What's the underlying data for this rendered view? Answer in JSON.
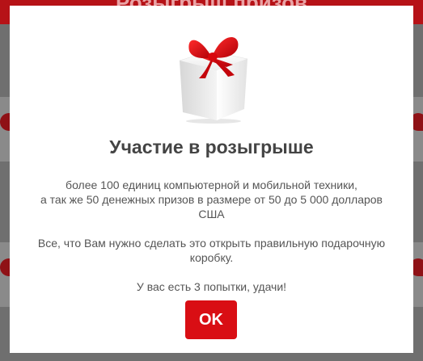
{
  "background": {
    "header_title": "Розыгрыш призов"
  },
  "modal": {
    "icon": "gift-box-icon",
    "title": "Участие в розыгрыше",
    "prizes_line1": "более 100 единиц компьютерной и мобильной техники,",
    "prizes_line2": "а так же 50 денежных призов в размере от 50 до 5 000 долларов США",
    "instructions": "Все, что Вам нужно сделать это открыть правильную подарочную коробку.",
    "attempts": "У вас есть 3 попытки, удачи!",
    "ok_label": "OK"
  },
  "colors": {
    "accent": "#d90e14",
    "header": "#b61217",
    "overlay": "#6f6f6f",
    "text": "#555555",
    "title": "#444444"
  }
}
